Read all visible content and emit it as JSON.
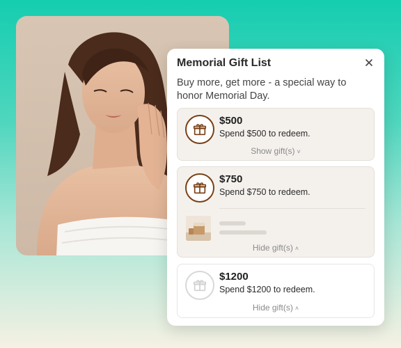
{
  "popup": {
    "title": "Memorial Gift List",
    "subtitle": "Buy more, get more - a special way to honor Memorial Day."
  },
  "tiers": [
    {
      "amount": "$500",
      "desc": "Spend $500 to redeem.",
      "toggle": "Show gift(s)",
      "chevron": "˅",
      "state": "collapsed"
    },
    {
      "amount": "$750",
      "desc": "Spend $750 to redeem.",
      "toggle": "Hide gift(s)",
      "chevron": "˄",
      "state": "expanded"
    },
    {
      "amount": "$1200",
      "desc": "Spend $1200 to redeem.",
      "toggle": "Hide gift(s)",
      "chevron": "˄",
      "state": "disabled"
    }
  ],
  "colors": {
    "accent": "#7a3f12",
    "background_top": "#15cdb0",
    "card_bg": "#f4f1ed"
  },
  "icons": {
    "gift": "gift-icon",
    "close": "close-icon"
  }
}
